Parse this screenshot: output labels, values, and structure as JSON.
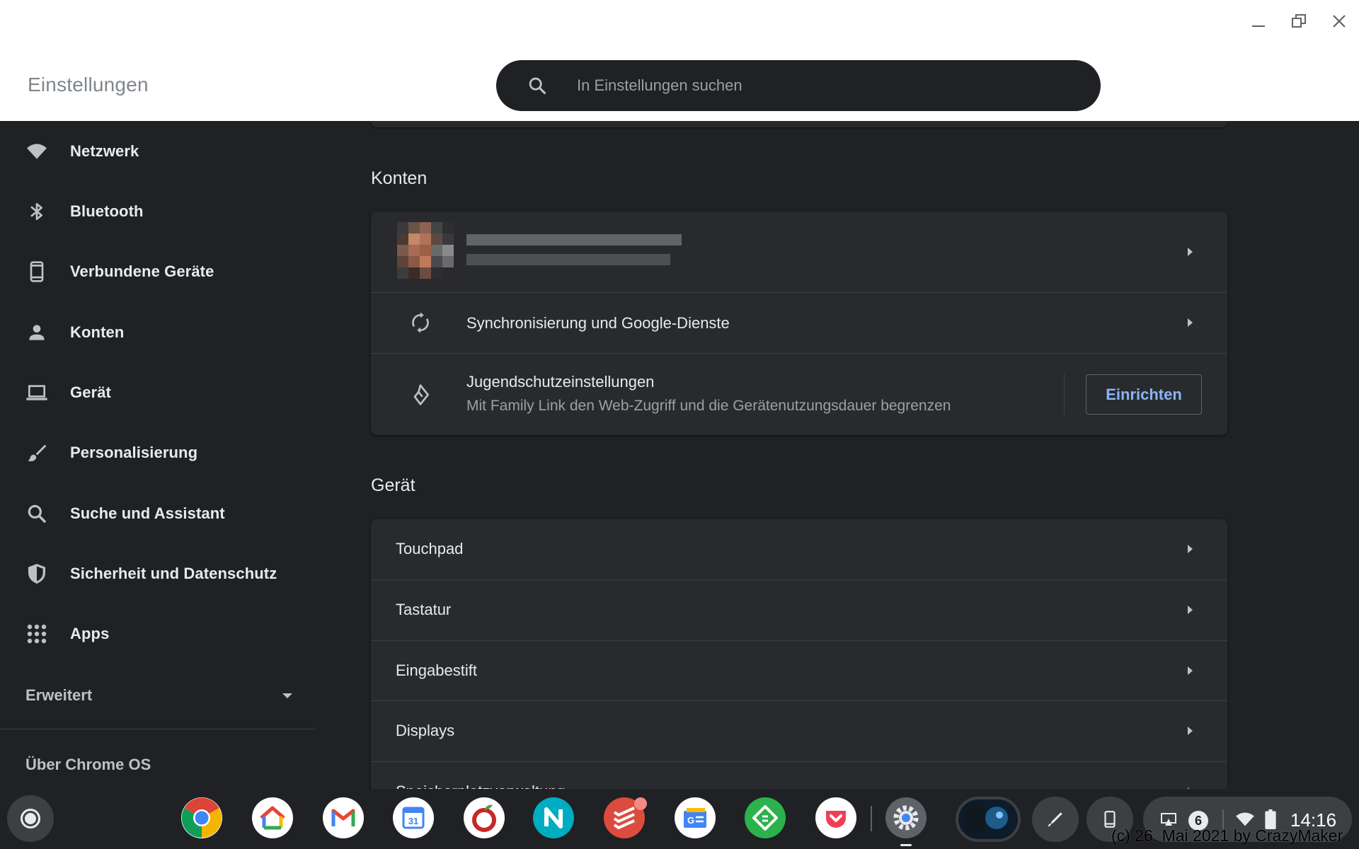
{
  "app": {
    "title": "Einstellungen"
  },
  "search": {
    "placeholder": "In Einstellungen suchen"
  },
  "sidebar": {
    "items": [
      {
        "label": "Netzwerk",
        "icon": "wifi-icon"
      },
      {
        "label": "Bluetooth",
        "icon": "bluetooth-icon"
      },
      {
        "label": "Verbundene Geräte",
        "icon": "phone-icon"
      },
      {
        "label": "Konten",
        "icon": "person-icon"
      },
      {
        "label": "Gerät",
        "icon": "laptop-icon"
      },
      {
        "label": "Personalisierung",
        "icon": "brush-icon"
      },
      {
        "label": "Suche und Assistant",
        "icon": "search-icon"
      },
      {
        "label": "Sicherheit und Datenschutz",
        "icon": "shield-icon"
      },
      {
        "label": "Apps",
        "icon": "apps-grid-icon"
      }
    ],
    "advanced_label": "Erweitert",
    "about_label": "Über Chrome OS"
  },
  "accounts": {
    "title": "Konten",
    "sync_label": "Synchronisierung und Google-Dienste",
    "parental_title": "Jugendschutzeinstellungen",
    "parental_desc": "Mit Family Link den Web-Zugriff und die Gerätenutzungsdauer begrenzen",
    "setup_button": "Einrichten"
  },
  "device": {
    "title": "Gerät",
    "rows": [
      "Touchpad",
      "Tastatur",
      "Eingabestift",
      "Displays",
      "Speicherplatzverwaltung"
    ]
  },
  "shelf": {
    "apps": [
      "chrome-icon",
      "google-home-icon",
      "gmail-icon",
      "google-calendar-icon",
      "inoreader-icon",
      "n-app-icon",
      "todoist-icon",
      "google-news-icon",
      "feedly-icon",
      "pocket-icon",
      "settings-gear-icon"
    ],
    "notification_count": "6",
    "time": "14:16"
  },
  "watermark": "(c) 26. Mai 2021 by CrazyMaker",
  "colors": {
    "background": "#202124",
    "card": "#292a2d",
    "accent": "#8ab4f8",
    "header": "#ffffff"
  }
}
